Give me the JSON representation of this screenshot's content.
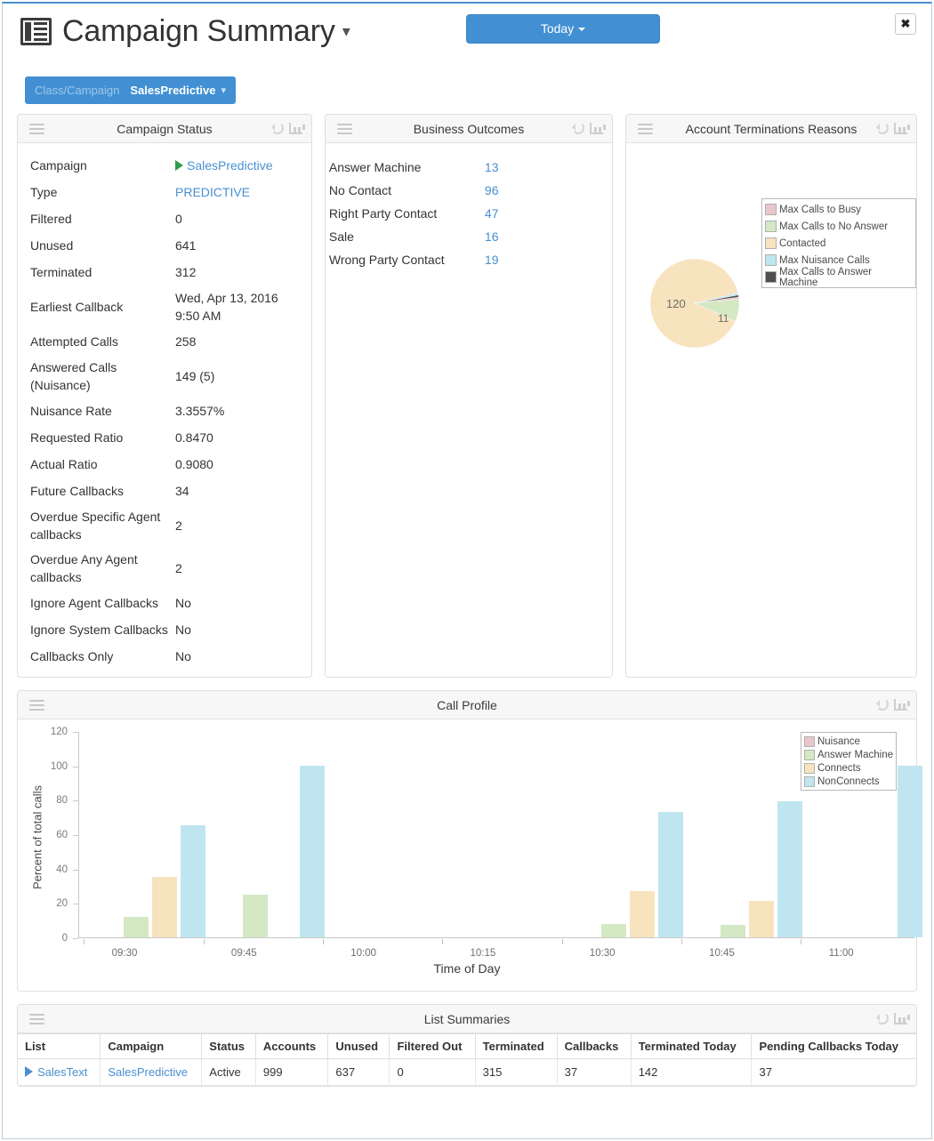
{
  "header": {
    "title": "Campaign Summary",
    "title_caret": "▾",
    "today_button": "Today",
    "close_label": "✖",
    "filter": {
      "label": "Class/Campaign",
      "value": "SalesPredictive",
      "caret": "▾"
    }
  },
  "campaign_status": {
    "title": "Campaign Status",
    "rows": [
      {
        "key": "Campaign",
        "value": "SalesPredictive",
        "style": "link-play"
      },
      {
        "key": "Type",
        "value": "PREDICTIVE",
        "style": "link"
      },
      {
        "key": "Filtered",
        "value": "0",
        "style": "plain"
      },
      {
        "key": "Unused",
        "value": "641",
        "style": "plain"
      },
      {
        "key": "Terminated",
        "value": "312",
        "style": "plain"
      },
      {
        "key": "Earliest Callback",
        "value": "Wed, Apr 13, 2016 9:50 AM",
        "style": "plain"
      },
      {
        "key": "Attempted Calls",
        "value": "258",
        "style": "plain"
      },
      {
        "key": "Answered Calls (Nuisance)",
        "value": "149 (5)",
        "style": "plain"
      },
      {
        "key": "Nuisance Rate",
        "value": "3.3557%",
        "style": "plain"
      },
      {
        "key": "Requested Ratio",
        "value": "0.8470",
        "style": "plain"
      },
      {
        "key": "Actual Ratio",
        "value": "0.9080",
        "style": "plain"
      },
      {
        "key": "Future Callbacks",
        "value": "34",
        "style": "plain"
      },
      {
        "key": "Overdue Specific Agent callbacks",
        "value": "2",
        "style": "plain"
      },
      {
        "key": "Overdue Any Agent callbacks",
        "value": "2",
        "style": "plain"
      },
      {
        "key": "Ignore Agent Callbacks",
        "value": "No",
        "style": "plain"
      },
      {
        "key": "Ignore System Callbacks",
        "value": "No",
        "style": "plain"
      },
      {
        "key": "Callbacks Only",
        "value": "No",
        "style": "plain"
      }
    ]
  },
  "business_outcomes": {
    "title": "Business Outcomes",
    "rows": [
      {
        "key": "Answer Machine",
        "value": "13"
      },
      {
        "key": "No Contact",
        "value": "96"
      },
      {
        "key": "Right Party Contact",
        "value": "47"
      },
      {
        "key": "Sale",
        "value": "16"
      },
      {
        "key": "Wrong Party Contact",
        "value": "19"
      }
    ]
  },
  "terminations": {
    "title": "Account Terminations Reasons",
    "chart_data": {
      "type": "pie",
      "title": "Account Terminations Reasons",
      "labels": [
        "Max Calls to Busy",
        "Max Calls to No Answer",
        "Contacted",
        "Max Nuisance Calls",
        "Max Calls to Answer Machine"
      ],
      "values": [
        1,
        11,
        120,
        1,
        1
      ],
      "colors": [
        "#e9c6cb",
        "#d4e8c3",
        "#f8e3bf",
        "#bfe6f0",
        "#4f4f4f"
      ],
      "data_labels": [
        "",
        "11",
        "120",
        "",
        ""
      ],
      "legend_position": "top-right"
    }
  },
  "call_profile": {
    "title": "Call Profile",
    "chart_data": {
      "type": "bar",
      "title": "Call Profile",
      "xlabel": "Time of Day",
      "ylabel": "Percent of total calls",
      "ylim": [
        0,
        120
      ],
      "yticks": [
        0,
        20,
        40,
        60,
        80,
        100,
        120
      ],
      "grid": false,
      "legend_position": "top-right",
      "categories": [
        "09:30",
        "09:45",
        "10:00",
        "10:15",
        "10:30",
        "10:45",
        "11:00"
      ],
      "series": [
        {
          "name": "Nuisance",
          "color": "#e9c6cb",
          "values": [
            0,
            0,
            0,
            0,
            0,
            0,
            0
          ]
        },
        {
          "name": "Answer Machine",
          "color": "#d4e8c3",
          "values": [
            12,
            25,
            0,
            0,
            8,
            7,
            0
          ]
        },
        {
          "name": "Connects",
          "color": "#f8e3bf",
          "values": [
            35,
            0,
            0,
            0,
            27,
            21,
            0
          ]
        },
        {
          "name": "NonConnects",
          "color": "#bfe6f0",
          "values": [
            65,
            100,
            0,
            0,
            73,
            79,
            100
          ]
        }
      ]
    }
  },
  "list_summaries": {
    "title": "List Summaries",
    "columns": [
      "List",
      "Campaign",
      "Status",
      "Accounts",
      "Unused",
      "Filtered Out",
      "Terminated",
      "Callbacks",
      "Terminated Today",
      "Pending Callbacks Today"
    ],
    "rows": [
      {
        "list": "SalesText",
        "campaign": "SalesPredictive",
        "status": "Active",
        "accounts": "999",
        "unused": "637",
        "filtered_out": "0",
        "terminated": "315",
        "callbacks": "37",
        "terminated_today": "142",
        "pending_callbacks_today": "37"
      }
    ]
  },
  "icons": {
    "menu": "hamburger-icon",
    "refresh": "refresh-icon",
    "chart": "bar-chart-icon"
  },
  "colors": {
    "accent": "#4290d3",
    "link": "#4a8fd0",
    "play_green": "#2e9e4b"
  }
}
